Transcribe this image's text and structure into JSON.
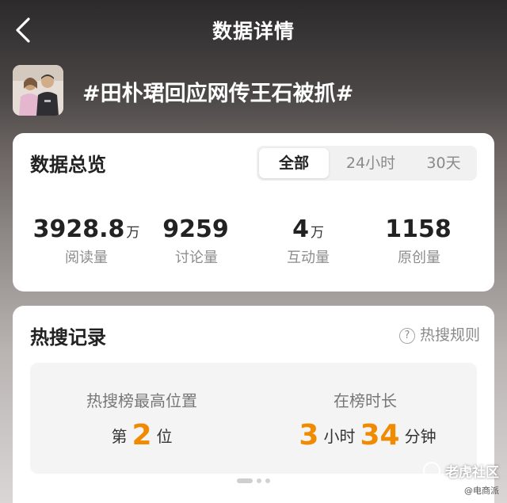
{
  "header": {
    "title": "数据详情"
  },
  "topic": {
    "title": "#田朴珺回应网传王石被抓#"
  },
  "overview": {
    "title": "数据总览",
    "tabs": [
      {
        "label": "全部",
        "active": true
      },
      {
        "label": "24小时",
        "active": false
      },
      {
        "label": "30天",
        "active": false
      }
    ],
    "stats": [
      {
        "value": "3928.8",
        "unit": "万",
        "label": "阅读量"
      },
      {
        "value": "9259",
        "unit": "",
        "label": "讨论量"
      },
      {
        "value": "4",
        "unit": "万",
        "label": "互动量"
      },
      {
        "value": "1158",
        "unit": "",
        "label": "原创量"
      }
    ]
  },
  "hot_search": {
    "title": "热搜记录",
    "rules_label": "热搜规则",
    "peak": {
      "heading": "热搜榜最高位置",
      "prefix": "第",
      "value": "2",
      "suffix": "位"
    },
    "duration": {
      "heading": "在榜时长",
      "hours": "3",
      "hours_unit": "小时",
      "minutes": "34",
      "minutes_unit": "分钟"
    }
  },
  "watermark": {
    "main": "老虎社区",
    "sub": "@电商派"
  },
  "colors": {
    "accent": "#f08a00"
  }
}
